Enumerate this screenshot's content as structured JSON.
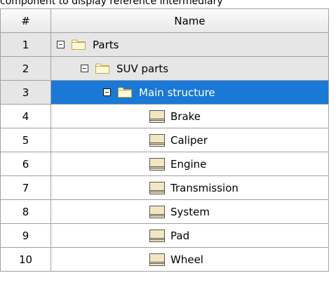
{
  "banner_text": "component to display reference intermediary",
  "columns": {
    "num": "#",
    "name": "Name"
  },
  "rows": [
    {
      "num": "1",
      "label": "Parts",
      "type": "folder",
      "expanded": true
    },
    {
      "num": "2",
      "label": "SUV parts",
      "type": "folder",
      "expanded": true
    },
    {
      "num": "3",
      "label": "Main structure",
      "type": "folder",
      "expanded": true,
      "selected": true
    },
    {
      "num": "4",
      "label": "Brake",
      "type": "part-icon"
    },
    {
      "num": "5",
      "label": "Caliper",
      "type": "part-icon"
    },
    {
      "num": "6",
      "label": "Engine",
      "type": "part-icon"
    },
    {
      "num": "7",
      "label": "Transmission",
      "type": "part-icon"
    },
    {
      "num": "8",
      "label": "System",
      "type": "part-icon"
    },
    {
      "num": "9",
      "label": "Pad",
      "type": "part-icon"
    },
    {
      "num": "10",
      "label": "Wheel",
      "type": "part-icon"
    }
  ],
  "colors": {
    "selection": "#1a78d6",
    "grey_row": "#e6e6e6",
    "grid": "#a0a0a0"
  }
}
